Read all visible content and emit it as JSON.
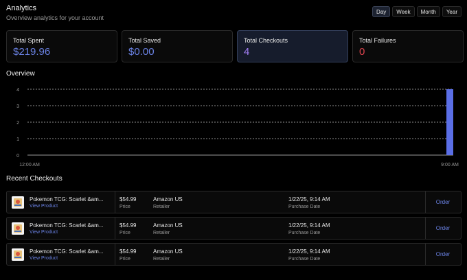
{
  "header": {
    "title": "Analytics",
    "subtitle": "Overview analytics for your account"
  },
  "ranges": [
    {
      "label": "Day",
      "active": true
    },
    {
      "label": "Week",
      "active": false
    },
    {
      "label": "Month",
      "active": false
    },
    {
      "label": "Year",
      "active": false
    }
  ],
  "stats": [
    {
      "label": "Total Spent",
      "value": "$219.96",
      "color": "#6b83e6"
    },
    {
      "label": "Total Saved",
      "value": "$0.00",
      "color": "#6b83e6"
    },
    {
      "label": "Total Checkouts",
      "value": "4",
      "color": "#a07cf0"
    },
    {
      "label": "Total Failures",
      "value": "0",
      "color": "#e0454f"
    }
  ],
  "overview_title": "Overview",
  "recent_title": "Recent Checkouts",
  "chart_data": {
    "type": "bar",
    "x": [
      "12:00 AM",
      "9:00 AM"
    ],
    "y_ticks": [
      0,
      1,
      2,
      3,
      4
    ],
    "ylim": [
      0,
      4
    ],
    "values": [
      4
    ],
    "grid": true,
    "bar_color": "#5a6ee6"
  },
  "checkouts": [
    {
      "product": "Pokemon TCG: Scarlet &am...",
      "link": "View Product",
      "price": "$54.99",
      "price_label": "Price",
      "retailer": "Amazon US",
      "retailer_label": "Retailer",
      "date": "1/22/25, 9:14 AM",
      "date_label": "Purchase Date",
      "action": "Order"
    },
    {
      "product": "Pokemon TCG: Scarlet &am...",
      "link": "View Product",
      "price": "$54.99",
      "price_label": "Price",
      "retailer": "Amazon US",
      "retailer_label": "Retailer",
      "date": "1/22/25, 9:14 AM",
      "date_label": "Purchase Date",
      "action": "Order"
    },
    {
      "product": "Pokemon TCG: Scarlet &am...",
      "link": "View Product",
      "price": "$54.99",
      "price_label": "Price",
      "retailer": "Amazon US",
      "retailer_label": "Retailer",
      "date": "1/22/25, 9:14 AM",
      "date_label": "Purchase Date",
      "action": "Order"
    }
  ]
}
